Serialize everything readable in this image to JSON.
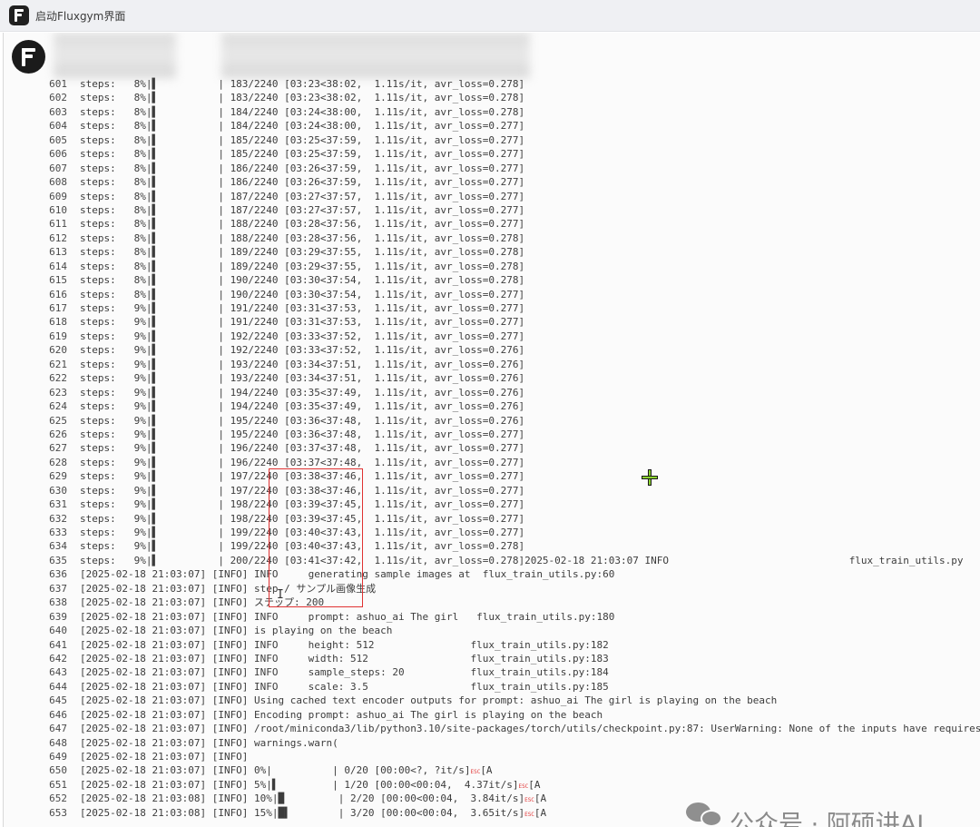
{
  "window": {
    "title": "启动Fluxgym界面"
  },
  "log_lines": [
    {
      "n": "601",
      "t": "steps:   8%|▌          | 183/2240 [03:23<38:02,  1.11s/it, avr_loss=0.278]"
    },
    {
      "n": "602",
      "t": "steps:   8%|▌          | 183/2240 [03:23<38:02,  1.11s/it, avr_loss=0.278]"
    },
    {
      "n": "603",
      "t": "steps:   8%|▌          | 184/2240 [03:24<38:00,  1.11s/it, avr_loss=0.278]"
    },
    {
      "n": "604",
      "t": "steps:   8%|▌          | 184/2240 [03:24<38:00,  1.11s/it, avr_loss=0.277]"
    },
    {
      "n": "605",
      "t": "steps:   8%|▌          | 185/2240 [03:25<37:59,  1.11s/it, avr_loss=0.277]"
    },
    {
      "n": "606",
      "t": "steps:   8%|▌          | 185/2240 [03:25<37:59,  1.11s/it, avr_loss=0.277]"
    },
    {
      "n": "607",
      "t": "steps:   8%|▌          | 186/2240 [03:26<37:59,  1.11s/it, avr_loss=0.277]"
    },
    {
      "n": "608",
      "t": "steps:   8%|▌          | 186/2240 [03:26<37:59,  1.11s/it, avr_loss=0.277]"
    },
    {
      "n": "609",
      "t": "steps:   8%|▌          | 187/2240 [03:27<37:57,  1.11s/it, avr_loss=0.277]"
    },
    {
      "n": "610",
      "t": "steps:   8%|▌          | 187/2240 [03:27<37:57,  1.11s/it, avr_loss=0.277]"
    },
    {
      "n": "611",
      "t": "steps:   8%|▌          | 188/2240 [03:28<37:56,  1.11s/it, avr_loss=0.277]"
    },
    {
      "n": "612",
      "t": "steps:   8%|▌          | 188/2240 [03:28<37:56,  1.11s/it, avr_loss=0.278]"
    },
    {
      "n": "613",
      "t": "steps:   8%|▌          | 189/2240 [03:29<37:55,  1.11s/it, avr_loss=0.278]"
    },
    {
      "n": "614",
      "t": "steps:   8%|▌          | 189/2240 [03:29<37:55,  1.11s/it, avr_loss=0.278]"
    },
    {
      "n": "615",
      "t": "steps:   8%|▌          | 190/2240 [03:30<37:54,  1.11s/it, avr_loss=0.278]"
    },
    {
      "n": "616",
      "t": "steps:   8%|▌          | 190/2240 [03:30<37:54,  1.11s/it, avr_loss=0.277]"
    },
    {
      "n": "617",
      "t": "steps:   9%|▌          | 191/2240 [03:31<37:53,  1.11s/it, avr_loss=0.277]"
    },
    {
      "n": "618",
      "t": "steps:   9%|▌          | 191/2240 [03:31<37:53,  1.11s/it, avr_loss=0.277]"
    },
    {
      "n": "619",
      "t": "steps:   9%|▌          | 192/2240 [03:33<37:52,  1.11s/it, avr_loss=0.277]"
    },
    {
      "n": "620",
      "t": "steps:   9%|▌          | 192/2240 [03:33<37:52,  1.11s/it, avr_loss=0.276]"
    },
    {
      "n": "621",
      "t": "steps:   9%|▌          | 193/2240 [03:34<37:51,  1.11s/it, avr_loss=0.276]"
    },
    {
      "n": "622",
      "t": "steps:   9%|▌          | 193/2240 [03:34<37:51,  1.11s/it, avr_loss=0.276]"
    },
    {
      "n": "623",
      "t": "steps:   9%|▌          | 194/2240 [03:35<37:49,  1.11s/it, avr_loss=0.276]"
    },
    {
      "n": "624",
      "t": "steps:   9%|▌          | 194/2240 [03:35<37:49,  1.11s/it, avr_loss=0.276]"
    },
    {
      "n": "625",
      "t": "steps:   9%|▌          | 195/2240 [03:36<37:48,  1.11s/it, avr_loss=0.276]"
    },
    {
      "n": "626",
      "t": "steps:   9%|▌          | 195/2240 [03:36<37:48,  1.11s/it, avr_loss=0.277]"
    },
    {
      "n": "627",
      "t": "steps:   9%|▌          | 196/2240 [03:37<37:48,  1.11s/it, avr_loss=0.277]"
    },
    {
      "n": "628",
      "t": "steps:   9%|▌          | 196/2240 [03:37<37:48,  1.11s/it, avr_loss=0.277]"
    },
    {
      "n": "629",
      "t": "steps:   9%|▌          | 197/2240 [03:38<37:46,  1.11s/it, avr_loss=0.277]"
    },
    {
      "n": "630",
      "t": "steps:   9%|▌          | 197/2240 [03:38<37:46,  1.11s/it, avr_loss=0.277]"
    },
    {
      "n": "631",
      "t": "steps:   9%|▌          | 198/2240 [03:39<37:45,  1.11s/it, avr_loss=0.277]"
    },
    {
      "n": "632",
      "t": "steps:   9%|▌          | 198/2240 [03:39<37:45,  1.11s/it, avr_loss=0.277]"
    },
    {
      "n": "633",
      "t": "steps:   9%|▌          | 199/2240 [03:40<37:43,  1.11s/it, avr_loss=0.277]"
    },
    {
      "n": "634",
      "t": "steps:   9%|▌          | 199/2240 [03:40<37:43,  1.11s/it, avr_loss=0.278]"
    },
    {
      "n": "635",
      "t": "steps:   9%|▌          | 200/2240 [03:41<37:42,  1.11s/it, avr_loss=0.278]2025-02-18 21:03:07 INFO                              flux_train_utils.py"
    },
    {
      "n": "636",
      "t": "[2025-02-18 21:03:07] [INFO] INFO     generating sample images at  flux_train_utils.py:60"
    },
    {
      "n": "637",
      "t": "[2025-02-18 21:03:07] [INFO] step / サンプル画像生成"
    },
    {
      "n": "638",
      "t": "[2025-02-18 21:03:07] [INFO] ステップ: 200"
    },
    {
      "n": "639",
      "t": "[2025-02-18 21:03:07] [INFO] INFO     prompt: ashuo_ai The girl   flux_train_utils.py:180"
    },
    {
      "n": "640",
      "t": "[2025-02-18 21:03:07] [INFO] is playing on the beach"
    },
    {
      "n": "641",
      "t": "[2025-02-18 21:03:07] [INFO] INFO     height: 512                flux_train_utils.py:182"
    },
    {
      "n": "642",
      "t": "[2025-02-18 21:03:07] [INFO] INFO     width: 512                 flux_train_utils.py:183"
    },
    {
      "n": "643",
      "t": "[2025-02-18 21:03:07] [INFO] INFO     sample_steps: 20           flux_train_utils.py:184"
    },
    {
      "n": "644",
      "t": "[2025-02-18 21:03:07] [INFO] INFO     scale: 3.5                 flux_train_utils.py:185"
    },
    {
      "n": "645",
      "t": "[2025-02-18 21:03:07] [INFO] Using cached text encoder outputs for prompt: ashuo_ai The girl is playing on the beach"
    },
    {
      "n": "646",
      "t": "[2025-02-18 21:03:07] [INFO] Encoding prompt: ashuo_ai The girl is playing on the beach"
    },
    {
      "n": "647",
      "t": "[2025-02-18 21:03:07] [INFO] /root/miniconda3/lib/python3.10/site-packages/torch/utils/checkpoint.py:87: UserWarning: None of the inputs have requires"
    },
    {
      "n": "648",
      "t": "[2025-02-18 21:03:07] [INFO] warnings.warn("
    },
    {
      "n": "649",
      "t": "[2025-02-18 21:03:07] [INFO]"
    },
    {
      "n": "650",
      "t": "[2025-02-18 21:03:07] [INFO] 0%|          | 0/20 [00:00<?, ?it/s]ESC[A"
    },
    {
      "n": "651",
      "t": "[2025-02-18 21:03:07] [INFO] 5%|▌         | 1/20 [00:00<00:04,  4.37it/s]ESC[A"
    },
    {
      "n": "652",
      "t": "[2025-02-18 21:03:08] [INFO] 10%|█         | 2/20 [00:00<00:04,  3.84it/s]ESC[A"
    },
    {
      "n": "653",
      "t": "[2025-02-18 21:03:08] [INFO] 15%|█▌        | 3/20 [00:00<00:04,  3.65it/s]ESC[A"
    }
  ],
  "watermark": {
    "text": "公众号 · 阿硕讲AI"
  },
  "colors": {
    "highlight": "#e03232",
    "cursor": "#8ad22e"
  },
  "icons": {
    "app": "fluxgym-logo-icon",
    "cursor": "move-cursor-icon",
    "watermark": "wechat-icon"
  }
}
